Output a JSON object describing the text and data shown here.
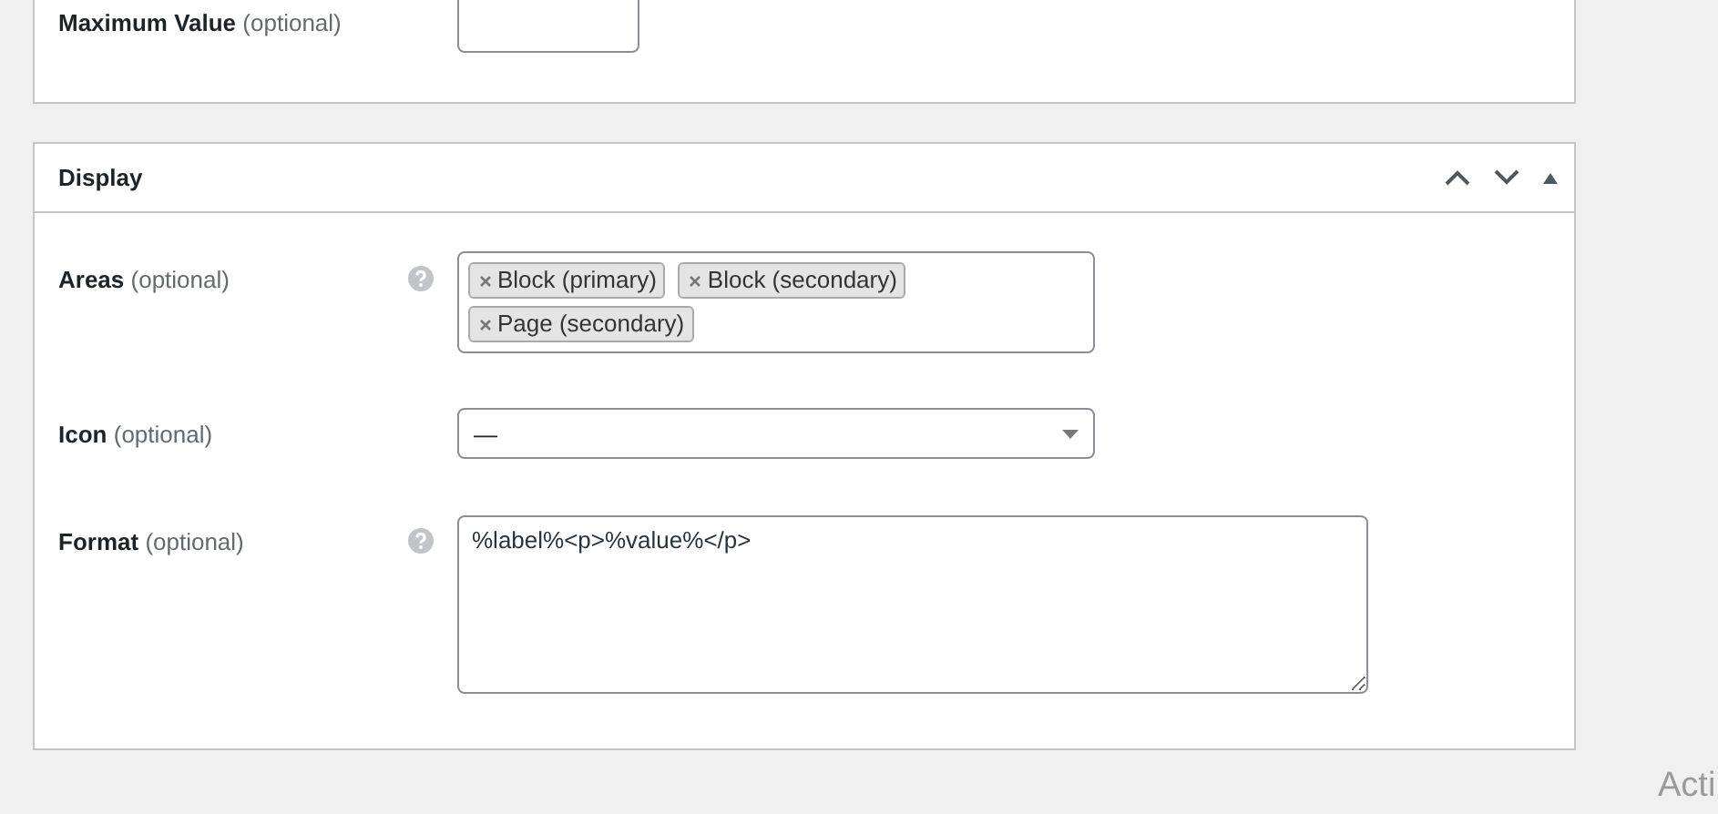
{
  "top_panel": {
    "fields": [
      {
        "kind": "number",
        "label": "Maximum Value",
        "hint": "(optional)"
      }
    ]
  },
  "display_panel": {
    "title": "Display",
    "fields": [
      {
        "kind": "tags",
        "label": "Areas",
        "hint": "(optional)",
        "help": true,
        "tags": [
          "Block (primary)",
          "Block (secondary)",
          "Page (secondary)"
        ]
      },
      {
        "kind": "select",
        "label": "Icon",
        "hint": "(optional)",
        "help": false,
        "value": "—"
      },
      {
        "kind": "textarea",
        "label": "Format",
        "hint": "(optional)",
        "help": true,
        "value": "%label%<p>%value%</p>"
      }
    ]
  },
  "os_overlay": {
    "text": "Acti"
  }
}
